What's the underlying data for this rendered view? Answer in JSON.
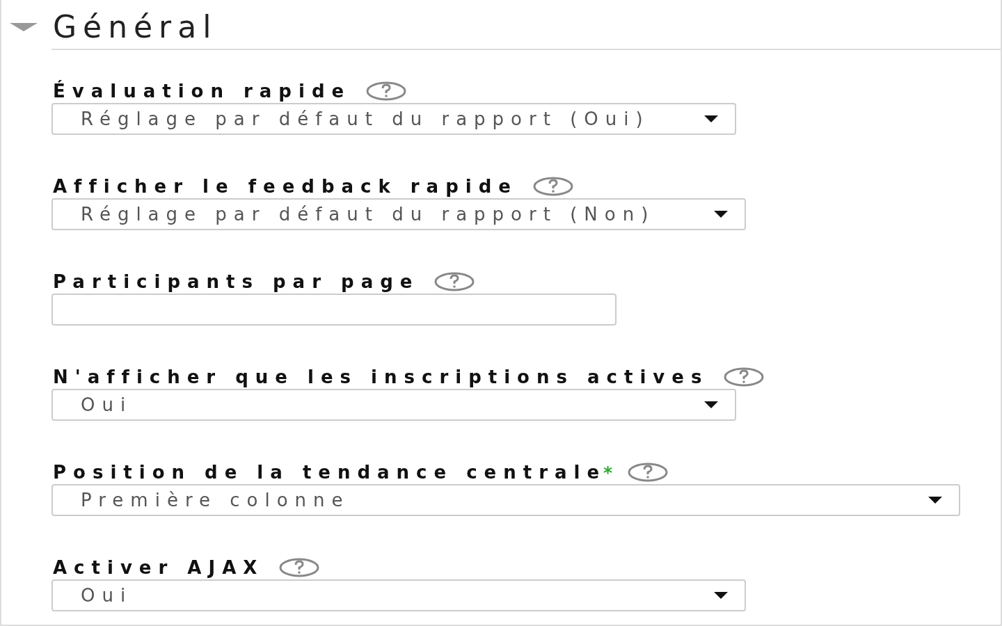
{
  "section": {
    "title": "Général",
    "expanded": true
  },
  "required_symbol": "*",
  "fields": [
    {
      "kind": "select",
      "label": "Évaluation rapide",
      "required": false,
      "value": "Réglage par défaut du rapport (Oui)"
    },
    {
      "kind": "select",
      "label": "Afficher le feedback rapide",
      "required": false,
      "value": "Réglage par défaut du rapport (Non)"
    },
    {
      "kind": "input",
      "label": "Participants par page",
      "required": false
    },
    {
      "kind": "select",
      "label": "N'afficher que les inscriptions actives",
      "required": false,
      "value": "Oui"
    },
    {
      "kind": "select",
      "label": "Position de la tendance centrale",
      "required": true,
      "value": "Première colonne"
    },
    {
      "kind": "select",
      "label": "Activer AJAX",
      "required": false,
      "value": "Oui"
    }
  ]
}
